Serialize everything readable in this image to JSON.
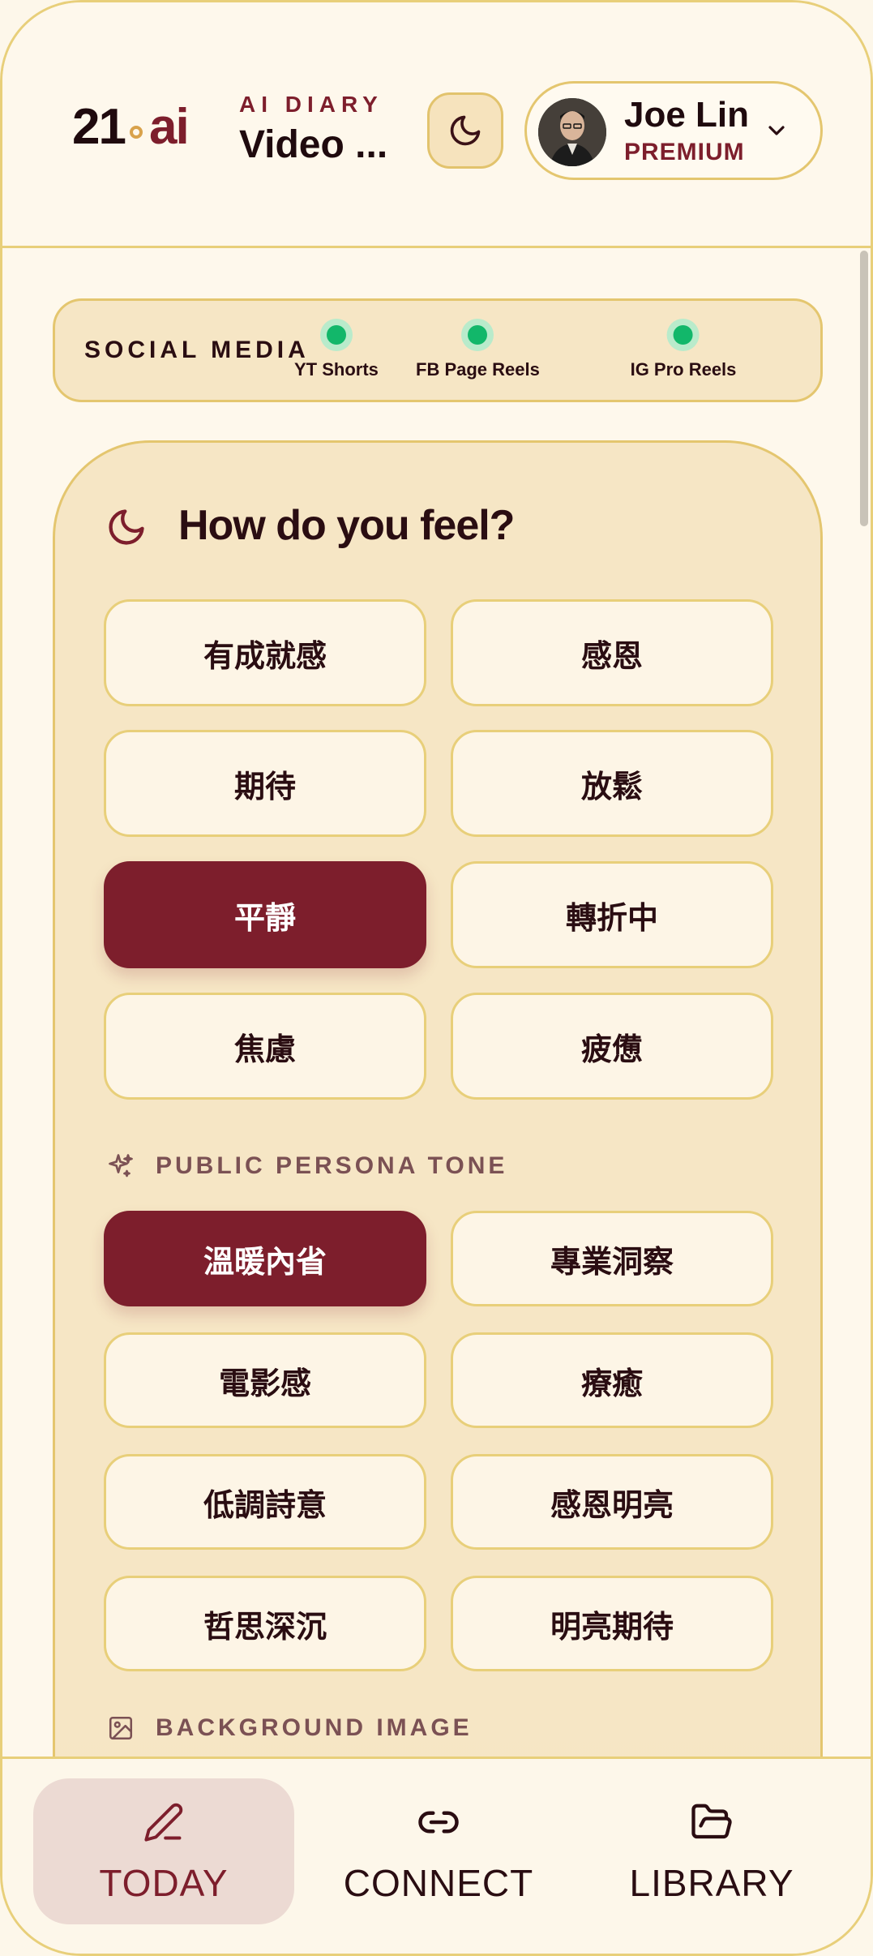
{
  "header": {
    "logo": {
      "number": "21",
      "ai": "ai"
    },
    "kicker": "AI DIARY",
    "title": "Video ...",
    "user": {
      "name": "Joe Lin",
      "tier": "PREMIUM"
    }
  },
  "social_media": {
    "label": "SOCIAL MEDIA",
    "platforms": [
      {
        "name": "YT Shorts",
        "connected": true
      },
      {
        "name": "FB Page Reels",
        "connected": true
      },
      {
        "name": "IG Pro Reels",
        "connected": true
      }
    ]
  },
  "feel": {
    "title": "How do you feel?",
    "selected": "平靜",
    "options": [
      "有成就感",
      "感恩",
      "期待",
      "放鬆",
      "平靜",
      "轉折中",
      "焦慮",
      "疲憊"
    ]
  },
  "persona": {
    "label": "PUBLIC PERSONA TONE",
    "selected": "溫暖內省",
    "options": [
      "溫暖內省",
      "專業洞察",
      "電影感",
      "療癒",
      "低調詩意",
      "感恩明亮",
      "哲思深沉",
      "明亮期待"
    ]
  },
  "background": {
    "label": "BACKGROUND IMAGE"
  },
  "bottom_nav": {
    "active": "TODAY",
    "items": [
      {
        "label": "TODAY",
        "icon": "pencil-icon"
      },
      {
        "label": "CONNECT",
        "icon": "link-icon"
      },
      {
        "label": "LIBRARY",
        "icon": "folder-icon"
      }
    ]
  },
  "colors": {
    "accent": "#7d1e2c",
    "card": "#f6e6c5",
    "chip": "#fdf5e6",
    "border": "#e4c66f",
    "status_connected": "#12b76a"
  }
}
